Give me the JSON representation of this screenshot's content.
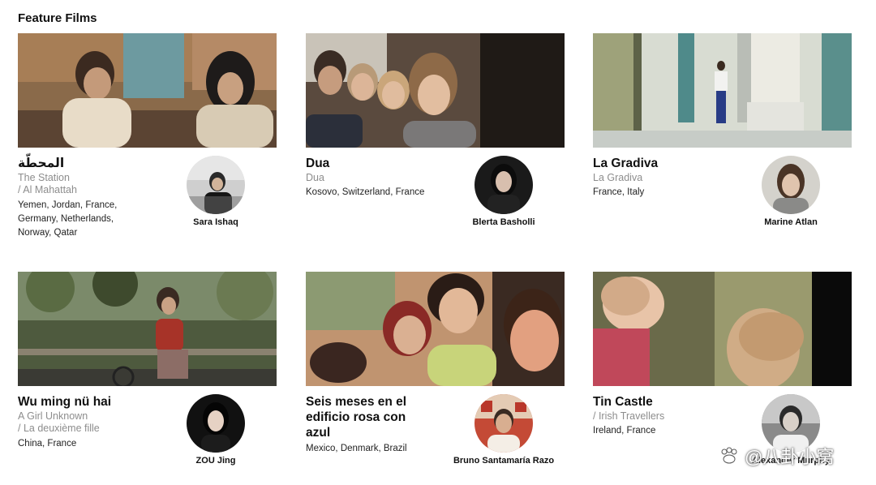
{
  "section_title": "Feature Films",
  "films": [
    {
      "title": "المحطّة",
      "subtitle_1": "The Station",
      "subtitle_2": "/ Al Mahattah",
      "countries": "Yemen, Jordan, France, Germany, Netherlands, Norway, Qatar",
      "director": "Sara Ishaq"
    },
    {
      "title": "Dua",
      "subtitle_1": "Dua",
      "subtitle_2": "",
      "countries": "Kosovo, Switzerland, France",
      "director": "Blerta Basholli"
    },
    {
      "title": "La Gradiva",
      "subtitle_1": "La Gradiva",
      "subtitle_2": "",
      "countries": "France, Italy",
      "director": "Marine Atlan"
    },
    {
      "title": "Wu ming nü hai",
      "subtitle_1": "A Girl Unknown",
      "subtitle_2": "/ La deuxième fille",
      "countries": "China, France",
      "director": "ZOU Jing"
    },
    {
      "title": "Seis meses en el edificio rosa con azul",
      "subtitle_1": "",
      "subtitle_2": "",
      "countries": "Mexico, Denmark, Brazil",
      "director": "Bruno Santamaría Razo"
    },
    {
      "title": "Tin Castle",
      "subtitle_1": "/ Irish Travellers",
      "subtitle_2": "",
      "countries": "Ireland, France",
      "director": "Alexander Murphy"
    }
  ],
  "watermark": {
    "text": "@八卦小窝",
    "icon": "weibo-paw-icon"
  }
}
